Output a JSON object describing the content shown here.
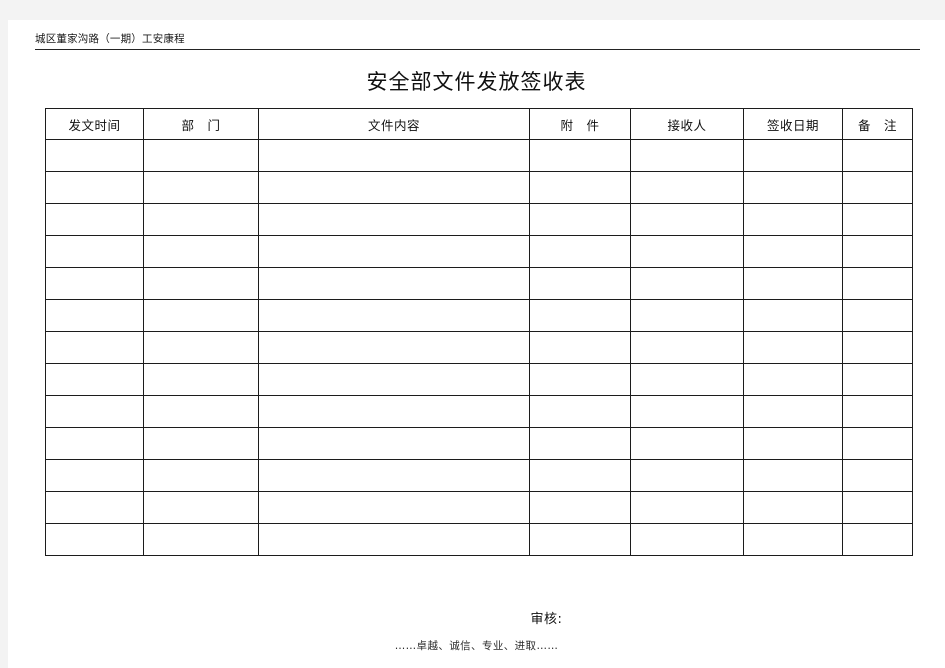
{
  "document": {
    "running_header": "城区董家沟路（一期）工安康程",
    "title": "安全部文件发放签收表",
    "reviewer_label": "审核:",
    "footer_slogan": "……卓越、诚信、专业、进取……"
  },
  "table": {
    "columns": [
      {
        "key": "date",
        "label": "发文时间"
      },
      {
        "key": "dept",
        "label": "部　门"
      },
      {
        "key": "content",
        "label": "文件内容"
      },
      {
        "key": "attach",
        "label": "附　件"
      },
      {
        "key": "recv",
        "label": "接收人"
      },
      {
        "key": "signdt",
        "label": "签收日期"
      },
      {
        "key": "remark",
        "label": "备　注"
      }
    ],
    "row_count": 13,
    "rows": [
      {
        "date": "",
        "dept": "",
        "content": "",
        "attach": "",
        "recv": "",
        "signdt": "",
        "remark": ""
      },
      {
        "date": "",
        "dept": "",
        "content": "",
        "attach": "",
        "recv": "",
        "signdt": "",
        "remark": ""
      },
      {
        "date": "",
        "dept": "",
        "content": "",
        "attach": "",
        "recv": "",
        "signdt": "",
        "remark": ""
      },
      {
        "date": "",
        "dept": "",
        "content": "",
        "attach": "",
        "recv": "",
        "signdt": "",
        "remark": ""
      },
      {
        "date": "",
        "dept": "",
        "content": "",
        "attach": "",
        "recv": "",
        "signdt": "",
        "remark": ""
      },
      {
        "date": "",
        "dept": "",
        "content": "",
        "attach": "",
        "recv": "",
        "signdt": "",
        "remark": ""
      },
      {
        "date": "",
        "dept": "",
        "content": "",
        "attach": "",
        "recv": "",
        "signdt": "",
        "remark": ""
      },
      {
        "date": "",
        "dept": "",
        "content": "",
        "attach": "",
        "recv": "",
        "signdt": "",
        "remark": ""
      },
      {
        "date": "",
        "dept": "",
        "content": "",
        "attach": "",
        "recv": "",
        "signdt": "",
        "remark": ""
      },
      {
        "date": "",
        "dept": "",
        "content": "",
        "attach": "",
        "recv": "",
        "signdt": "",
        "remark": ""
      },
      {
        "date": "",
        "dept": "",
        "content": "",
        "attach": "",
        "recv": "",
        "signdt": "",
        "remark": ""
      },
      {
        "date": "",
        "dept": "",
        "content": "",
        "attach": "",
        "recv": "",
        "signdt": "",
        "remark": ""
      },
      {
        "date": "",
        "dept": "",
        "content": "",
        "attach": "",
        "recv": "",
        "signdt": "",
        "remark": ""
      }
    ]
  },
  "colors": {
    "page_background": "#ffffff",
    "canvas_background": "#f3f3f3",
    "border": "#1c1c1c",
    "text": "#111111"
  }
}
